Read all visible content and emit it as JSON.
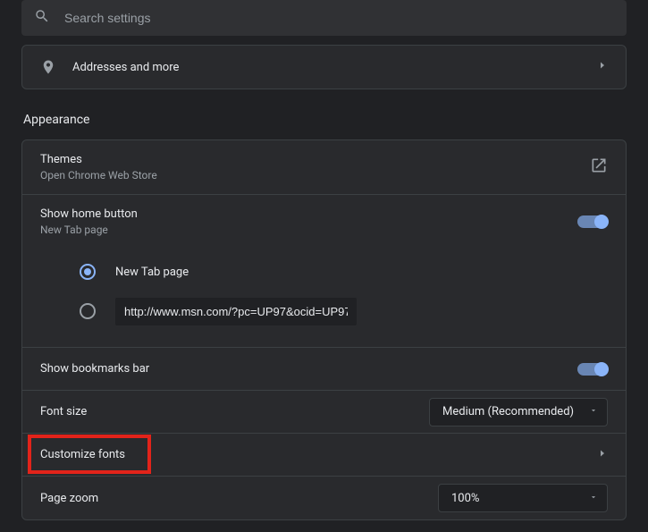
{
  "search": {
    "placeholder": "Search settings"
  },
  "addresses": {
    "label": "Addresses and more"
  },
  "section": {
    "title": "Appearance"
  },
  "themes": {
    "label": "Themes",
    "sub": "Open Chrome Web Store"
  },
  "home_button": {
    "label": "Show home button",
    "sub": "New Tab page",
    "option_newtab": "New Tab page",
    "option_url_value": "http://www.msn.com/?pc=UP97&ocid=UP97..."
  },
  "bookmarks": {
    "label": "Show bookmarks bar"
  },
  "font_size": {
    "label": "Font size",
    "value": "Medium (Recommended)"
  },
  "customize_fonts": {
    "label": "Customize fonts"
  },
  "page_zoom": {
    "label": "Page zoom",
    "value": "100%"
  }
}
